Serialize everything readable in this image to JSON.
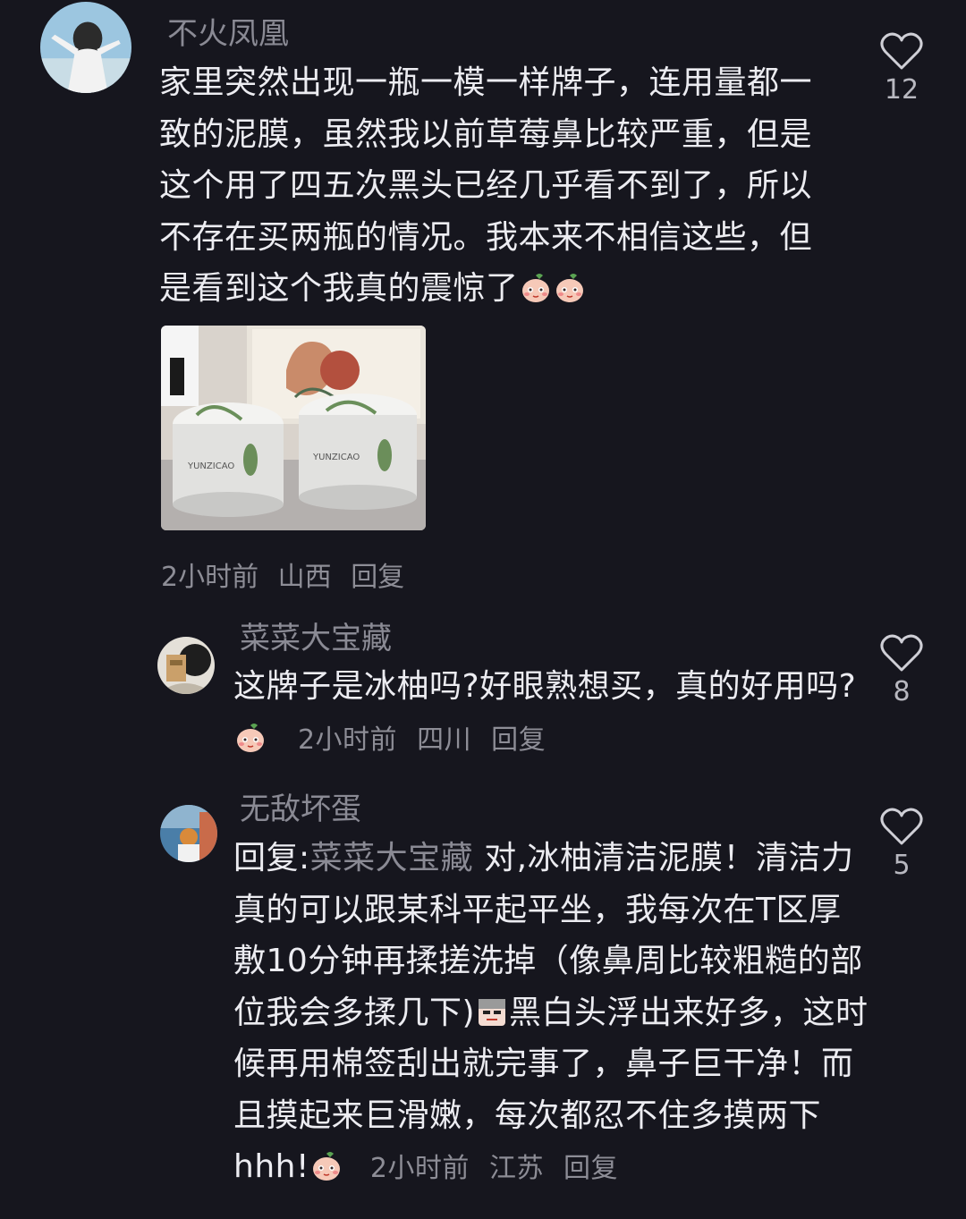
{
  "comments": [
    {
      "author": "不火凤凰",
      "text": "家里突然出现一瓶一模一样牌子，连用量都一致的泥膜，虽然我以前草莓鼻比较严重，但是这个用了四五次黑头已经几乎看不到了，所以不存在买两瓶的情况。我本来不相信这些，但是看到这个我真的震惊了",
      "emojis": [
        "blush-face-emoji",
        "blush-face-emoji"
      ],
      "time": "2小时前",
      "location": "山西",
      "reply_label": "回复",
      "likes": "12",
      "image_description": "product-photo-two-mud-mask-jars",
      "jar_brand_text": "YUNZICAO"
    },
    {
      "author": "菜菜大宝藏",
      "text": "这牌子是冰柚吗?好眼熟想买，真的好用吗?",
      "emojis": [
        "blush-face-emoji"
      ],
      "time": "2小时前",
      "location": "四川",
      "reply_label": "回复",
      "likes": "8"
    },
    {
      "author": "无敌坏蛋",
      "reply_prefix": "回复:",
      "reply_to": "菜菜大宝藏",
      "text_part1": " 对,冰柚清洁泥膜！清洁力真的可以跟某科平起平坐，我每次在T区厚敷10分钟再揉搓洗掉（像鼻周比较粗糙的部位我会多揉几下)",
      "text_part2": "黑白头浮出来好多，这时候再用棉签刮出就完事了，鼻子巨干净！而且摸起来巨滑嫩，每次都忍不住多摸两下hhh!",
      "emojis": [
        "sly-face-emoji",
        "blush-face-emoji"
      ],
      "time": "2小时前",
      "location": "江苏",
      "reply_label": "回复",
      "likes": "5"
    }
  ]
}
